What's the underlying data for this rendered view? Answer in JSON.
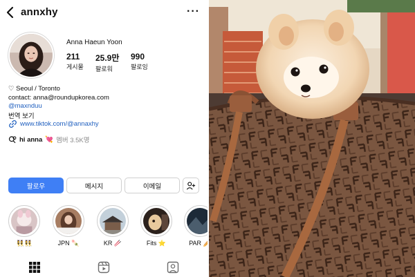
{
  "header": {
    "back_icon": "chevron-left-icon",
    "username": "annxhy",
    "more_icon": "ellipsis-icon",
    "more_label": "···"
  },
  "profile": {
    "full_name": "Anna Haeun Yoon",
    "stats": [
      {
        "value": "211",
        "label": "게시물"
      },
      {
        "value": "25.9만",
        "label": "팔로워"
      },
      {
        "value": "990",
        "label": "팔로잉"
      }
    ]
  },
  "bio": {
    "location": "♡ Seoul / Toronto",
    "contact": "contact: anna@roundupkorea.com",
    "mention": "@maxnduu",
    "translate": "번역 보기",
    "link_text": "www.tiktok.com/@annaxhy",
    "thread_name": "hi anna",
    "thread_emoji": "💘",
    "thread_members": "멤버 3.5K명"
  },
  "buttons": {
    "follow": "팔로우",
    "message": "메시지",
    "email": "이메일",
    "add_person_icon": "add-person-icon"
  },
  "highlights": [
    {
      "label": "👯👯"
    },
    {
      "label": "JPN 🍡"
    },
    {
      "label": "KR 🥢"
    },
    {
      "label": "Fits ⭐"
    },
    {
      "label": "PAR 🥖"
    }
  ],
  "tabs": [
    "grid-icon",
    "reels-icon",
    "tagged-icon"
  ],
  "colors": {
    "accent": "#3f7ff5",
    "link": "#1f5fbf"
  }
}
